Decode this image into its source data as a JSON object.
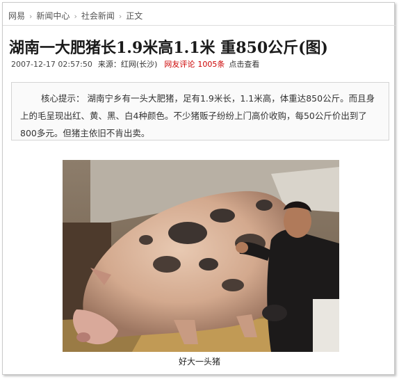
{
  "breadcrumb": {
    "items": [
      "网易",
      "新闻中心",
      "社会新闻",
      "正文"
    ],
    "separator": "›"
  },
  "article": {
    "title": "湖南一大肥猪长1.9米高1.1米 重850公斤(图)",
    "datetime": "2007-12-17 02:57:50",
    "source": "来源：红网(长沙)",
    "comment_label": "网友评论",
    "comment_count": "1005",
    "comment_unit": "条",
    "view_label": "点击查看",
    "summary": "核心提示： 湖南宁乡有一头大肥猪，足有1.9米长，1.1米高，体重达850公斤。而且身上的毛呈现出红、黄、黑、白4种颜色。不少猪贩子纷纷上门高价收购，每50公斤价出到了800多元。但猪主依旧不肯出卖。",
    "photo_caption": "好大一头猪"
  },
  "colors": {
    "link_red": "#cc0000",
    "border": "#d4d4d4",
    "summary_bg": "#fafafa"
  }
}
